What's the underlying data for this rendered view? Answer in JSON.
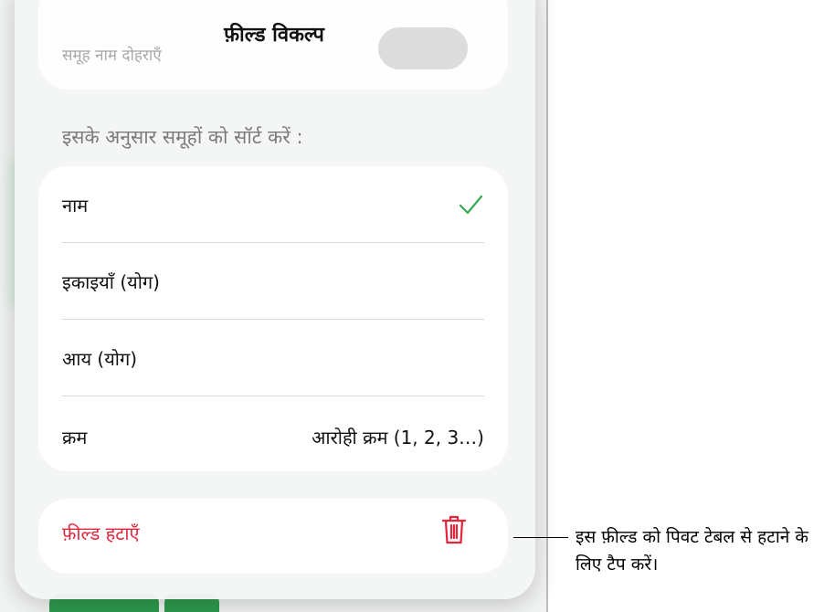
{
  "sheet": {
    "title": "फ़ील्ड विकल्प",
    "repeat_group_names_label": "समूह नाम दोहराएँ"
  },
  "sort_section": {
    "header": "इसके अनुसार समूहों को सॉर्ट करें :",
    "options": [
      {
        "label": "नाम",
        "selected": true
      },
      {
        "label": "इकाइयाँ (योग)",
        "selected": false
      },
      {
        "label": "आय (योग)",
        "selected": false
      }
    ],
    "order": {
      "label": "क्रम",
      "value": "आरोही क्रम (1, 2, 3…)"
    }
  },
  "delete": {
    "label": "फ़ील्ड हटाएँ",
    "icon": "trash-icon"
  },
  "callout": {
    "text": "इस फ़ील्ड को पिवट टेबल से हटाने के लिए टैप करें।"
  },
  "colors": {
    "accent_green": "#34a853",
    "destructive_red": "#e3243b"
  }
}
